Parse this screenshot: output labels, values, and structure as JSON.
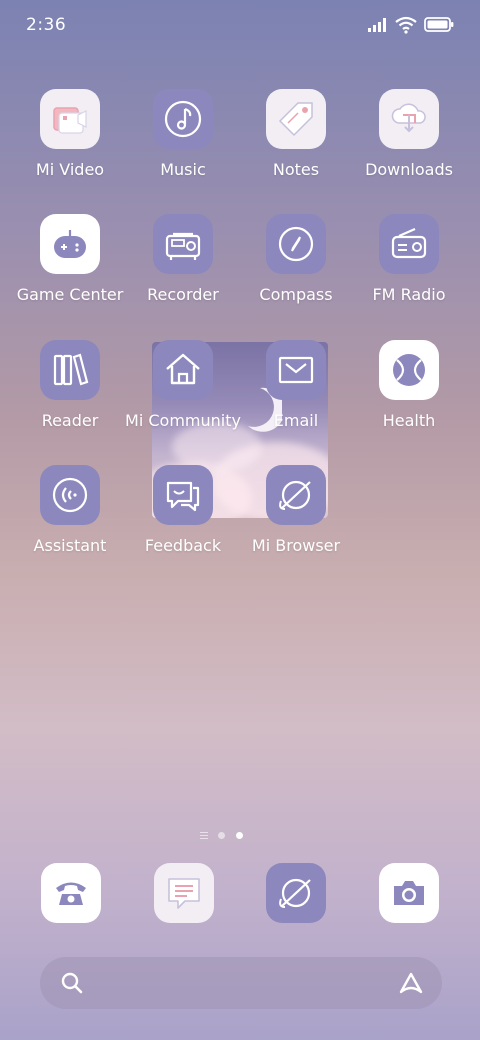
{
  "status_bar": {
    "time": "2:36"
  },
  "apps": [
    {
      "name": "mi-video",
      "label": "Mi Video"
    },
    {
      "name": "music",
      "label": "Music"
    },
    {
      "name": "notes",
      "label": "Notes"
    },
    {
      "name": "downloads",
      "label": "Downloads"
    },
    {
      "name": "game-center",
      "label": "Game Center"
    },
    {
      "name": "recorder",
      "label": "Recorder"
    },
    {
      "name": "compass",
      "label": "Compass"
    },
    {
      "name": "fm-radio",
      "label": "FM Radio"
    },
    {
      "name": "reader",
      "label": "Reader"
    },
    {
      "name": "mi-community",
      "label": "Mi Community"
    },
    {
      "name": "email",
      "label": "Email"
    },
    {
      "name": "health",
      "label": "Health"
    },
    {
      "name": "assistant",
      "label": "Assistant"
    },
    {
      "name": "feedback",
      "label": "Feedback"
    },
    {
      "name": "mi-browser",
      "label": "Mi Browser"
    }
  ],
  "page_indicator": {
    "pages": 3,
    "active": 3
  },
  "dock": [
    "phone",
    "messages",
    "browser",
    "camera"
  ],
  "colors": {
    "icon_purple": "#8c88bd",
    "icon_light": "#f2eef4",
    "accent_pink": "#e9a3b0"
  }
}
